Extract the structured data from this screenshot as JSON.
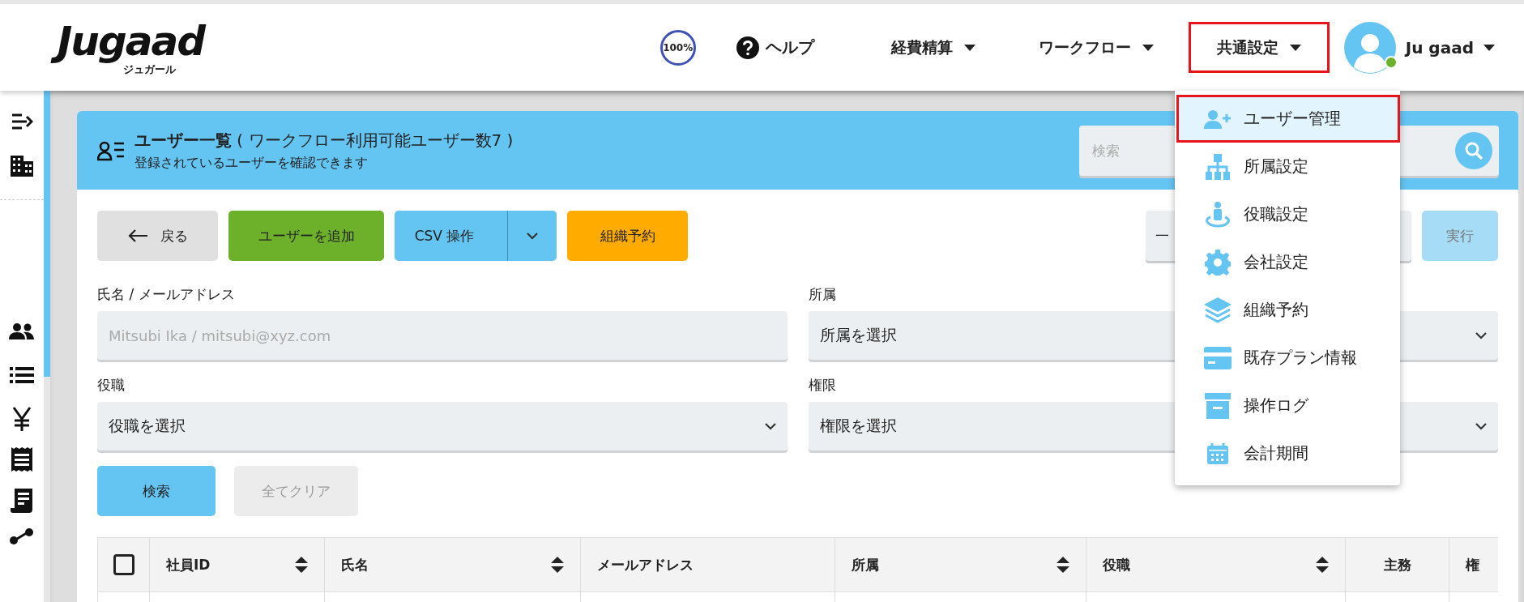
{
  "header": {
    "logo": "Jugaad",
    "logo_sub": "ジュガール",
    "progress_badge": "100%",
    "help": "ヘルプ",
    "nav": [
      {
        "label": "経費精算",
        "highlighted": false
      },
      {
        "label": "ワークフロー",
        "highlighted": false
      },
      {
        "label": "共通設定",
        "highlighted": true
      }
    ],
    "user": {
      "name": "Ju gaad",
      "online": true
    }
  },
  "menu": [
    {
      "label": "ユーザー管理",
      "selected": true,
      "highlighted": true
    },
    {
      "label": "所属設定",
      "selected": false,
      "highlighted": false
    },
    {
      "label": "役職設定",
      "selected": false,
      "highlighted": false
    },
    {
      "label": "会社設定",
      "selected": false,
      "highlighted": false
    },
    {
      "label": "組織予約",
      "selected": false,
      "highlighted": false
    },
    {
      "label": "既存プラン情報",
      "selected": false,
      "highlighted": false
    },
    {
      "label": "操作ログ",
      "selected": false,
      "highlighted": false
    },
    {
      "label": "会計期間",
      "selected": false,
      "highlighted": false
    }
  ],
  "page": {
    "title": "ユーザー一覧",
    "title_note": "( ワークフロー利用可能ユーザー数7 )",
    "subtitle": "登録されているユーザーを確認できます",
    "search": {
      "placeholder": "検索"
    }
  },
  "toolbar": {
    "back": "戻る",
    "add": "ユーザーを追加",
    "csv": "CSV 操作",
    "reserve": "組織予約",
    "bulk_select": {
      "value": "一"
    },
    "run": {
      "label": "実行",
      "disabled": true
    }
  },
  "filters": [
    {
      "label": "氏名 / メールアドレス",
      "kind": "text",
      "placeholder": "Mitsubi Ika / mitsubi@xyz.com"
    },
    {
      "label": "所属",
      "kind": "select",
      "value": "所属を選択"
    },
    {
      "label": "役職",
      "kind": "select",
      "value": "役職を選択"
    },
    {
      "label": "権限",
      "kind": "select",
      "value": "権限を選択"
    }
  ],
  "search_button": "検索",
  "clear_button": {
    "label": "全てクリア",
    "disabled": true
  },
  "table": {
    "select_all": {
      "checked": false
    },
    "columns": [
      {
        "label": "社員ID",
        "sortable": true
      },
      {
        "label": "氏名",
        "sortable": true
      },
      {
        "label": "メールアドレス",
        "sortable": false
      },
      {
        "label": "所属",
        "sortable": true
      },
      {
        "label": "役職",
        "sortable": true
      },
      {
        "label": "主務",
        "sortable": false
      },
      {
        "label": "権",
        "sortable": false
      }
    ]
  }
}
